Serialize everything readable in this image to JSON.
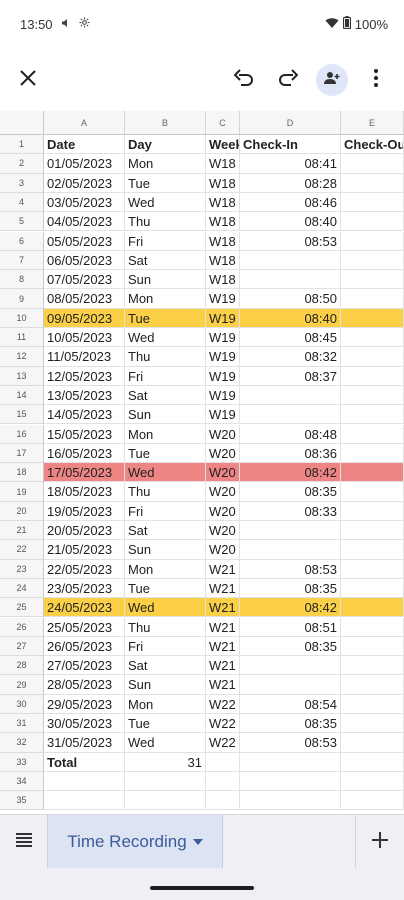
{
  "status_bar": {
    "time": "13:50",
    "battery": "100%",
    "icons": [
      "volume-icon",
      "settings-icon",
      "wifi-icon",
      "battery-icon"
    ]
  },
  "toolbar": {
    "icons": [
      "close-icon",
      "undo-icon",
      "redo-icon",
      "add-person-icon",
      "more-vert-icon"
    ]
  },
  "sheet": {
    "column_letters": [
      "A",
      "B",
      "C",
      "D",
      "E"
    ],
    "headers": [
      "Date",
      "Day",
      "Week",
      "Check-In",
      "Check-Out"
    ],
    "rows": [
      {
        "n": "2",
        "date": "01/05/2023",
        "day": "Mon",
        "week": "W18",
        "checkin": "08:41",
        "hl": ""
      },
      {
        "n": "3",
        "date": "02/05/2023",
        "day": "Tue",
        "week": "W18",
        "checkin": "08:28",
        "hl": ""
      },
      {
        "n": "4",
        "date": "03/05/2023",
        "day": "Wed",
        "week": "W18",
        "checkin": "08:46",
        "hl": ""
      },
      {
        "n": "5",
        "date": "04/05/2023",
        "day": "Thu",
        "week": "W18",
        "checkin": "08:40",
        "hl": ""
      },
      {
        "n": "6",
        "date": "05/05/2023",
        "day": "Fri",
        "week": "W18",
        "checkin": "08:53",
        "hl": ""
      },
      {
        "n": "7",
        "date": "06/05/2023",
        "day": "Sat",
        "week": "W18",
        "checkin": "",
        "hl": ""
      },
      {
        "n": "8",
        "date": "07/05/2023",
        "day": "Sun",
        "week": "W18",
        "checkin": "",
        "hl": ""
      },
      {
        "n": "9",
        "date": "08/05/2023",
        "day": "Mon",
        "week": "W19",
        "checkin": "08:50",
        "hl": ""
      },
      {
        "n": "10",
        "date": "09/05/2023",
        "day": "Tue",
        "week": "W19",
        "checkin": "08:40",
        "hl": "yellow"
      },
      {
        "n": "11",
        "date": "10/05/2023",
        "day": "Wed",
        "week": "W19",
        "checkin": "08:45",
        "hl": ""
      },
      {
        "n": "12",
        "date": "11/05/2023",
        "day": "Thu",
        "week": "W19",
        "checkin": "08:32",
        "hl": ""
      },
      {
        "n": "13",
        "date": "12/05/2023",
        "day": "Fri",
        "week": "W19",
        "checkin": "08:37",
        "hl": ""
      },
      {
        "n": "14",
        "date": "13/05/2023",
        "day": "Sat",
        "week": "W19",
        "checkin": "",
        "hl": ""
      },
      {
        "n": "15",
        "date": "14/05/2023",
        "day": "Sun",
        "week": "W19",
        "checkin": "",
        "hl": ""
      },
      {
        "n": "16",
        "date": "15/05/2023",
        "day": "Mon",
        "week": "W20",
        "checkin": "08:48",
        "hl": ""
      },
      {
        "n": "17",
        "date": "16/05/2023",
        "day": "Tue",
        "week": "W20",
        "checkin": "08:36",
        "hl": ""
      },
      {
        "n": "18",
        "date": "17/05/2023",
        "day": "Wed",
        "week": "W20",
        "checkin": "08:42",
        "hl": "red"
      },
      {
        "n": "19",
        "date": "18/05/2023",
        "day": "Thu",
        "week": "W20",
        "checkin": "08:35",
        "hl": ""
      },
      {
        "n": "20",
        "date": "19/05/2023",
        "day": "Fri",
        "week": "W20",
        "checkin": "08:33",
        "hl": ""
      },
      {
        "n": "21",
        "date": "20/05/2023",
        "day": "Sat",
        "week": "W20",
        "checkin": "",
        "hl": ""
      },
      {
        "n": "22",
        "date": "21/05/2023",
        "day": "Sun",
        "week": "W20",
        "checkin": "",
        "hl": ""
      },
      {
        "n": "23",
        "date": "22/05/2023",
        "day": "Mon",
        "week": "W21",
        "checkin": "08:53",
        "hl": ""
      },
      {
        "n": "24",
        "date": "23/05/2023",
        "day": "Tue",
        "week": "W21",
        "checkin": "08:35",
        "hl": ""
      },
      {
        "n": "25",
        "date": "24/05/2023",
        "day": "Wed",
        "week": "W21",
        "checkin": "08:42",
        "hl": "yellow"
      },
      {
        "n": "26",
        "date": "25/05/2023",
        "day": "Thu",
        "week": "W21",
        "checkin": "08:51",
        "hl": ""
      },
      {
        "n": "27",
        "date": "26/05/2023",
        "day": "Fri",
        "week": "W21",
        "checkin": "08:35",
        "hl": ""
      },
      {
        "n": "28",
        "date": "27/05/2023",
        "day": "Sat",
        "week": "W21",
        "checkin": "",
        "hl": ""
      },
      {
        "n": "29",
        "date": "28/05/2023",
        "day": "Sun",
        "week": "W21",
        "checkin": "",
        "hl": ""
      },
      {
        "n": "30",
        "date": "29/05/2023",
        "day": "Mon",
        "week": "W22",
        "checkin": "08:54",
        "hl": ""
      },
      {
        "n": "31",
        "date": "30/05/2023",
        "day": "Tue",
        "week": "W22",
        "checkin": "08:35",
        "hl": ""
      },
      {
        "n": "32",
        "date": "31/05/2023",
        "day": "Wed",
        "week": "W22",
        "checkin": "08:53",
        "hl": ""
      }
    ],
    "total_row": {
      "n": "33",
      "label": "Total",
      "value": "31"
    },
    "empty_rows": [
      "34",
      "35"
    ]
  },
  "sheet_tabs": {
    "active_tab": "Time Recording",
    "icons": [
      "sheets-list-icon",
      "dropdown-caret-icon",
      "add-sheet-icon"
    ]
  },
  "colors": {
    "highlight_yellow": "#fbd047",
    "highlight_red": "#ee8585",
    "tab_active_text": "#3d5a9a"
  }
}
